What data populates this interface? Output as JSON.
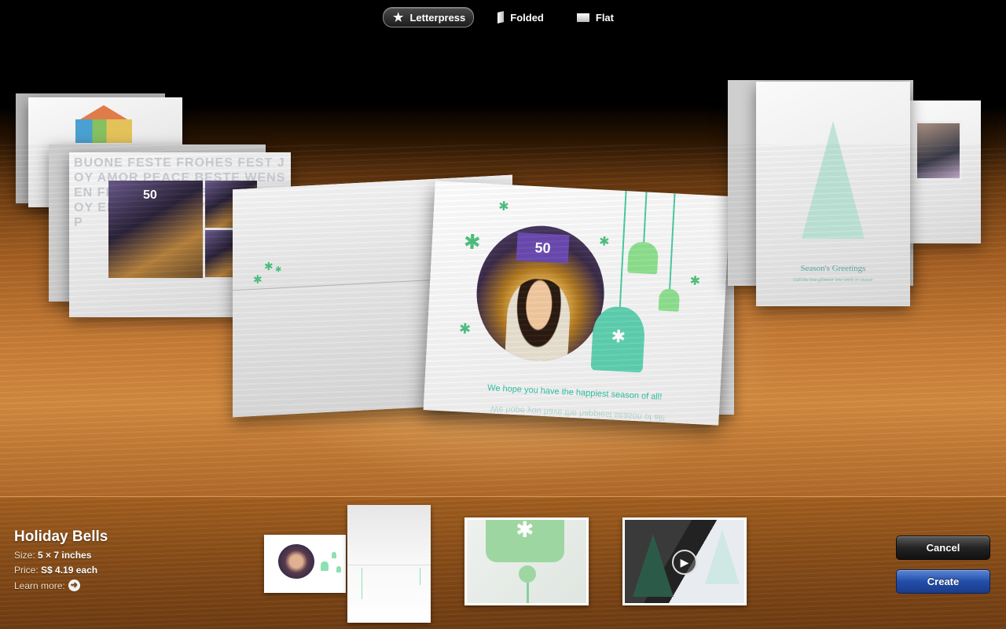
{
  "top_bar": {
    "options": [
      {
        "label": "Letterpress",
        "icon": "star-icon",
        "active": true
      },
      {
        "label": "Folded",
        "icon": "folded-card-icon",
        "active": false
      },
      {
        "label": "Flat",
        "icon": "flat-card-icon",
        "active": false
      }
    ]
  },
  "preview": {
    "left_card_words": "BUONE FESTE FROHES FEST JOY AMOR PEACE BESTE WENSEN FROHES FEST ВЕСЕЛЬЯ JOY ЕЕЕЁОЙ HAPPY НОВИХ МИР",
    "left_card_screen": "50",
    "main_card_screen": "50",
    "main_card_greeting": "We hope you have the happiest season of all!",
    "right_card_title": "Season's Greetings",
    "right_card_subtitle": "Call the tree-glimmer tree-smile in season"
  },
  "theme_info": {
    "name": "Holiday Bells",
    "size_label": "Size:",
    "size_value": "5 × 7 inches",
    "price_label": "Price:",
    "price_value": "S$ 4.19 each",
    "learn_more": "Learn more:"
  },
  "thumbnails": [
    {
      "name": "card-front-thumbnail"
    },
    {
      "name": "card-inside-thumbnail"
    },
    {
      "name": "letterpress-detail-thumbnail"
    },
    {
      "name": "video-thumbnail"
    }
  ],
  "buttons": {
    "cancel": "Cancel",
    "create": "Create"
  },
  "colors": {
    "accent_green": "#4cc07e",
    "bell_teal": "#5fd0b0",
    "create_blue": "#234ea8",
    "wood": "#c57a34"
  }
}
